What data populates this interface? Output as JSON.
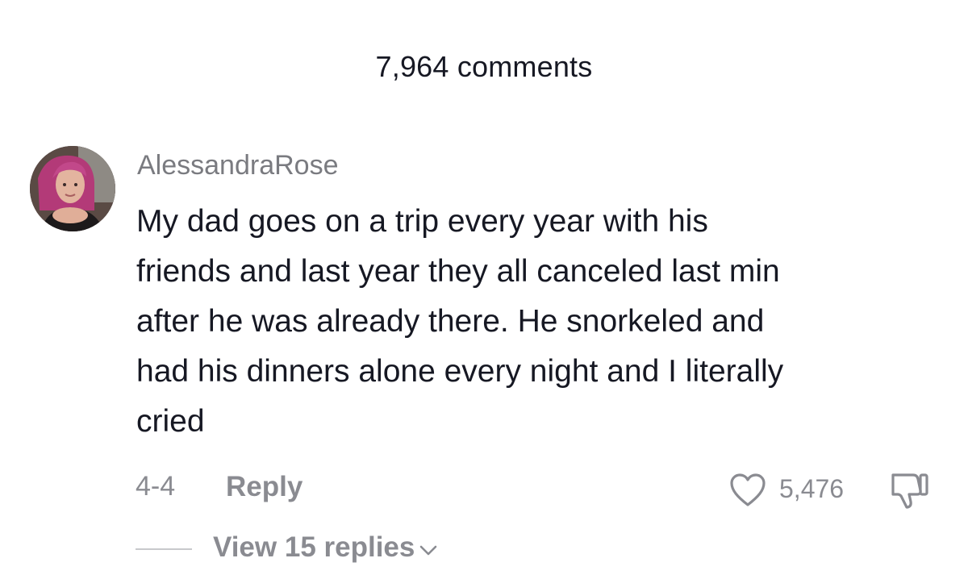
{
  "header": {
    "title": "7,964 comments"
  },
  "comment": {
    "avatar_icon": "user-avatar",
    "username": "AlessandraRose",
    "text_lines": [
      "My dad goes on a trip every year with his",
      "friends and last year they all canceled last min",
      "after he was already there. He snorkeled and",
      "had his dinners alone every night and I literally",
      "cried"
    ],
    "date": "4-4",
    "reply_label": "Reply",
    "like_icon": "heart-icon",
    "like_count": "5,476",
    "dislike_icon": "thumbs-down-icon",
    "view_replies_label": "View 15 replies",
    "view_replies_icon": "chevron-down-icon"
  }
}
